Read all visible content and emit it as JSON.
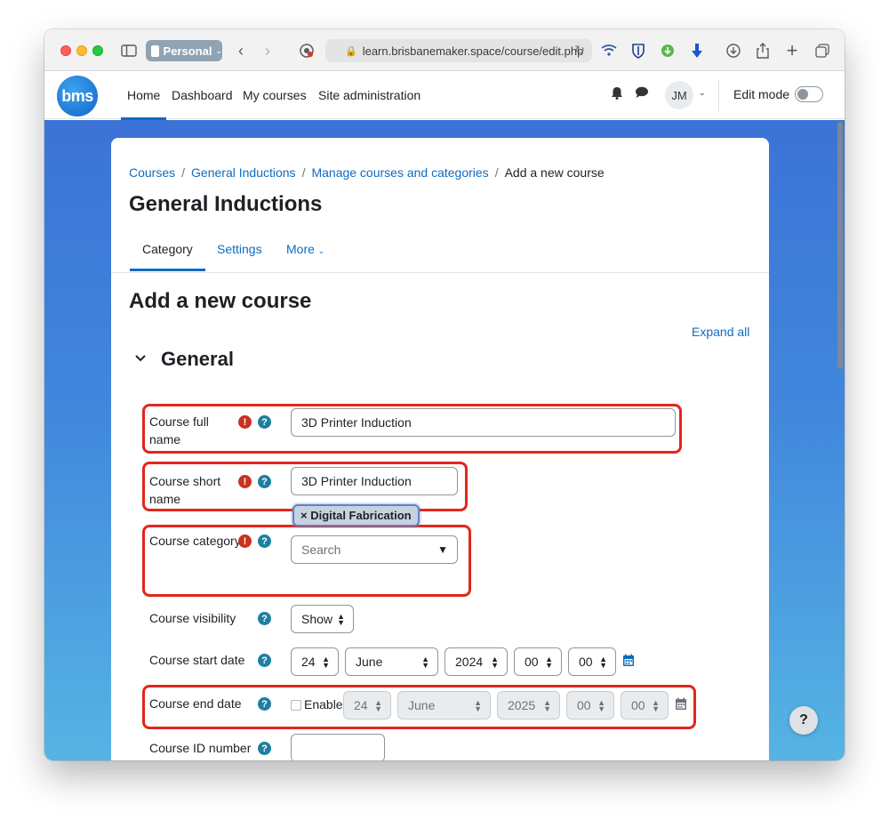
{
  "browser": {
    "profile_label": "Personal",
    "url": "learn.brisbanemaker.space/course/edit.php"
  },
  "navbar": {
    "logo_text": "bms",
    "links": [
      "Home",
      "Dashboard",
      "My courses",
      "Site administration"
    ],
    "active_link": "Home",
    "user_initials": "JM",
    "edit_mode_label": "Edit mode",
    "edit_mode_on": false
  },
  "breadcrumb": [
    "Courses",
    "General Inductions",
    "Manage courses and categories",
    "Add a new course"
  ],
  "course_heading": "General Inductions",
  "tabs": [
    "Category",
    "Settings",
    "More"
  ],
  "active_tab": "Category",
  "page_title": "Add a new course",
  "expand_all": "Expand all",
  "section": {
    "title": "General",
    "fields": {
      "full_name": {
        "label_line1": "Course full",
        "label_line2": "name",
        "value": "3D Printer Induction"
      },
      "short_name": {
        "label_line1": "Course short",
        "label_line2": "name",
        "value": "3D Printer Induction"
      },
      "category": {
        "label": "Course category",
        "selected_tag": "× Digital Fabrication",
        "search_placeholder": "Search"
      },
      "visibility": {
        "label": "Course visibility",
        "value": "Show"
      },
      "start_date": {
        "label": "Course start date",
        "day": "24",
        "month": "June",
        "year": "2024",
        "hour": "00",
        "minute": "00"
      },
      "end_date": {
        "label": "Course end date",
        "enable_label": "Enable",
        "enabled": false,
        "day": "24",
        "month": "June",
        "year": "2025",
        "hour": "00",
        "minute": "00"
      },
      "id_number": {
        "label": "Course ID number",
        "value": ""
      }
    }
  },
  "icons": {
    "required": "exclamation-icon",
    "help": "question-icon",
    "calendar": "calendar-icon"
  },
  "colors": {
    "link": "#0f6cbf",
    "required": "#ca3120",
    "help": "#1f7fa0",
    "highlight": "#e3261c"
  },
  "help_button": "?"
}
